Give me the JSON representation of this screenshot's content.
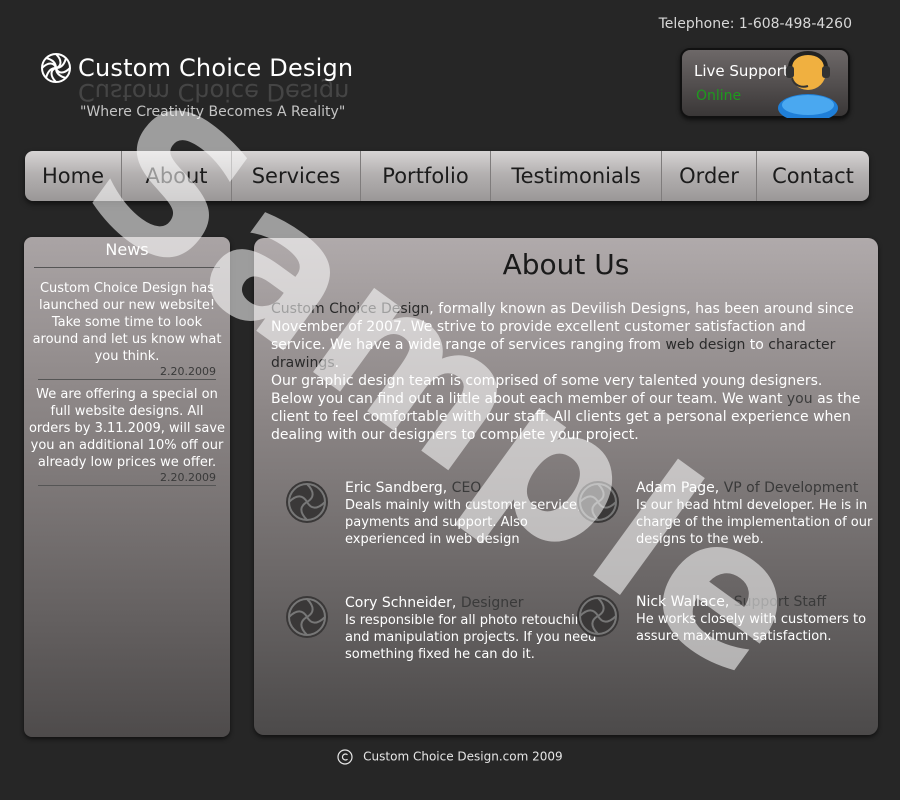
{
  "header": {
    "phone": "Telephone: 1-608-498-4260",
    "logo_text": "Custom Choice Design",
    "tagline": "\"Where Creativity Becomes A Reality\""
  },
  "support": {
    "title": "Live Support",
    "status": "Online",
    "status_color": "#1e9a1e"
  },
  "nav": {
    "items": [
      {
        "label": "Home"
      },
      {
        "label": "About"
      },
      {
        "label": "Services"
      },
      {
        "label": "Portfolio"
      },
      {
        "label": "Testimonials"
      },
      {
        "label": "Order"
      },
      {
        "label": "Contact"
      }
    ]
  },
  "news": {
    "title": "News",
    "items": [
      {
        "body": "Custom Choice Design has launched our new website!  Take some time to look around and let us know what you think.",
        "date": "2.20.2009"
      },
      {
        "body": "We are offering a special on full website designs.  All orders by 3.11.2009, will save you an additional 10% off our already low prices we offer.",
        "date": "2.20.2009"
      }
    ]
  },
  "main": {
    "title": "About Us",
    "p1": {
      "company": "Custom Choice Design",
      "t1": ", formally known as Devilish Designs, has been around since November of 2007.  We strive to provide excellent customer satisfaction and service.  We have a wide range of services ranging from ",
      "link1": "web design",
      "t2": " to ",
      "link2": "character drawings",
      "t3": "."
    },
    "p2": {
      "t1": "Our graphic design team is comprised of some very talented young designers.  Below you can find out a little about each member of our team.  We want ",
      "you": "you",
      "t2": " as the client to feel comfortable with our staff.  All clients get a personal experience when dealing with our designers to complete your project."
    },
    "members": [
      {
        "name": "Eric Sandberg, ",
        "role": "CEO",
        "desc": "Deals mainly with customer service, payments and support.  Also experienced in web design"
      },
      {
        "name": "Adam Page, ",
        "role": "VP of Development",
        "desc": "Is our head html developer.  He is in charge of the implementation of our designs to the web."
      },
      {
        "name": "Cory Schneider, ",
        "role": "Designer",
        "desc": "Is responsible for all photo retouching and manipulation projects.  If you need something fixed he can do it."
      },
      {
        "name": "Nick Wallace, ",
        "role": "Support Staff",
        "desc": "He works closely with customers to assure maximum satisfaction."
      }
    ]
  },
  "footer": {
    "text": "Custom Choice Design.com 2009",
    "icon": "copyright-icon"
  },
  "watermark": "Sample"
}
